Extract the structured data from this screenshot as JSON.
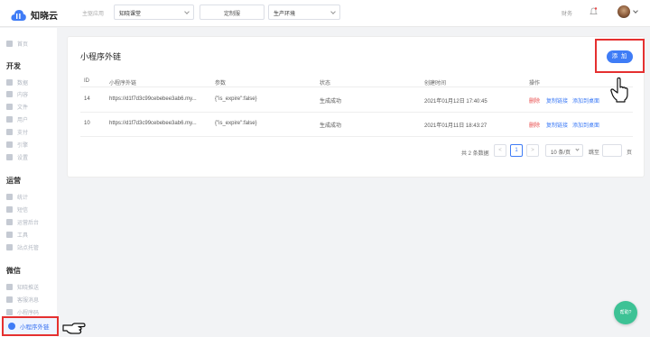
{
  "header": {
    "app_name": "知晓云",
    "current_app_label": "主驱应用",
    "app_select": "知晓课堂",
    "custom_domain_button": "定制服",
    "env_select": "生产环境",
    "finance": "财务"
  },
  "sidebar": {
    "overview": "首页",
    "sections": [
      {
        "title": "开发",
        "items": [
          "数据",
          "内容",
          "文件",
          "用户",
          "支付",
          "引擎",
          "设置"
        ]
      },
      {
        "title": "运营",
        "items": [
          "统计",
          "短信",
          "运营后台",
          "工具",
          "站点托管"
        ]
      },
      {
        "title": "微信",
        "items": [
          "知晓推送",
          "客服消息",
          "小程序码"
        ]
      }
    ],
    "active_item": "小程序外链"
  },
  "main": {
    "title": "小程序外链",
    "add_button": "添 加",
    "columns": [
      "ID",
      "小程序外链",
      "参数",
      "状态",
      "创建时间",
      "操作"
    ],
    "rows": [
      {
        "id": "14",
        "link": "https://d1f7d3c99cebebee3ab6.my...",
        "params": "{\"is_expire\":false}",
        "status": "生成成功",
        "created": "2021年01月12日 17:40:45",
        "ops": [
          "删除",
          "复制链接",
          "添加到桌面"
        ]
      },
      {
        "id": "10",
        "link": "https://d1f7d3c99cebebee3ab6.my...",
        "params": "{\"is_expire\":false}",
        "status": "生成成功",
        "created": "2021年01月11日 18:43:27",
        "ops": [
          "删除",
          "复制链接",
          "添加到桌面"
        ]
      }
    ],
    "pagination": {
      "total": "共 2 条数据",
      "prev": "<",
      "current": "1",
      "next": ">",
      "page_size": "10 条/页",
      "goto_label": "跳至",
      "page_suffix": "页"
    }
  },
  "help_button": "帮助?",
  "colors": {
    "accent": "#3f7cf6",
    "danger": "#e84a4a",
    "highlight": "#e53030",
    "help": "#3dc295"
  }
}
